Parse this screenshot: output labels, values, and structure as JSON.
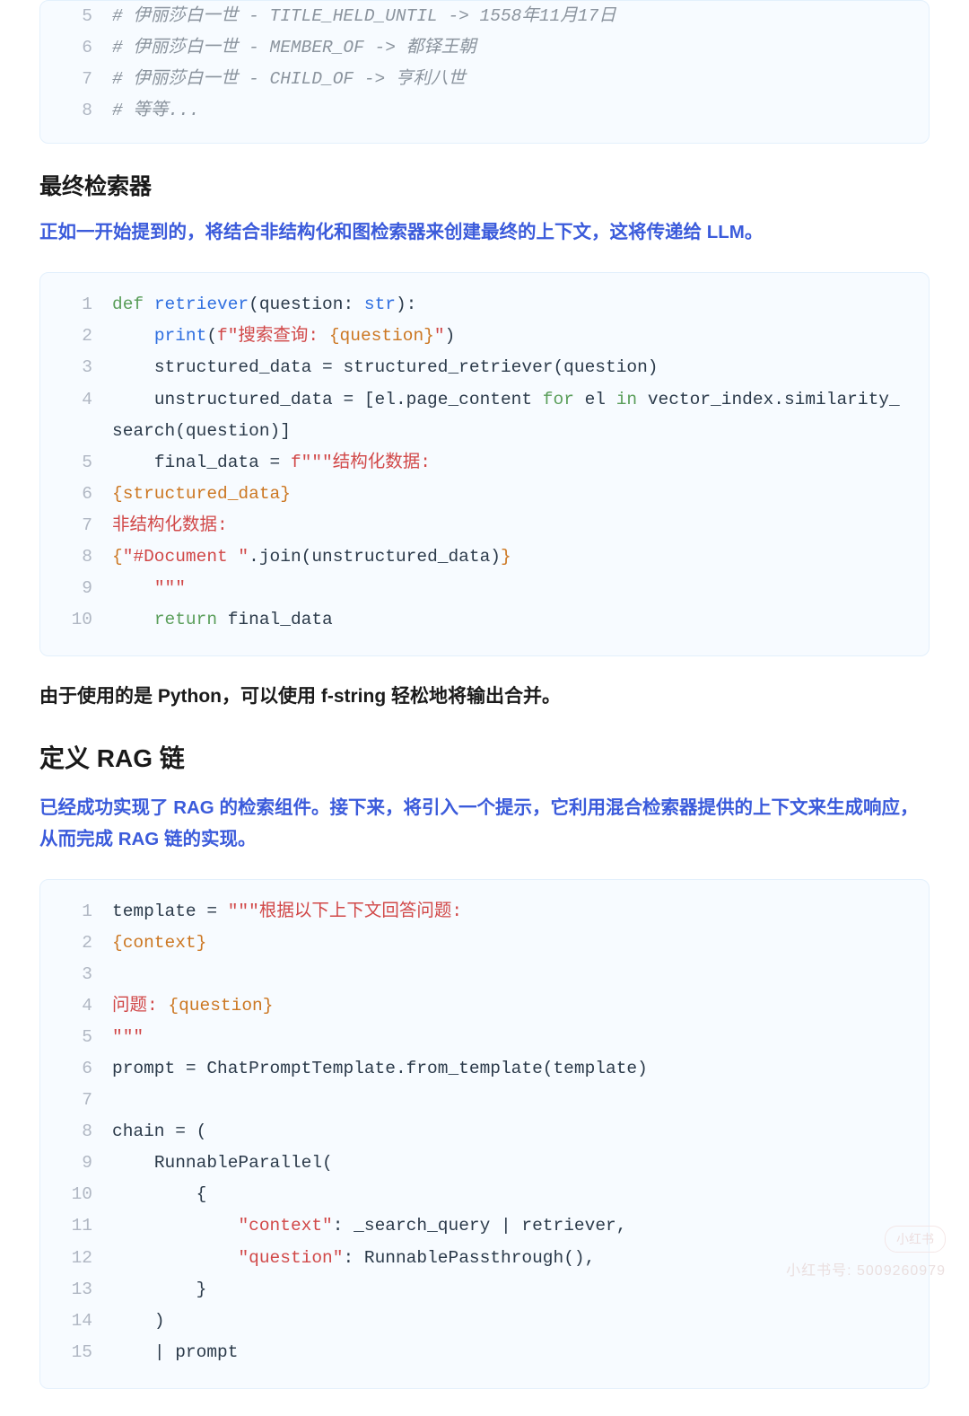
{
  "code_block_1": {
    "lines": [
      {
        "n": 5,
        "segments": [
          {
            "cls": "tok-comment",
            "t": "# 伊丽莎白一世 - TITLE_HELD_UNTIL -> 1558年11月17日"
          }
        ]
      },
      {
        "n": 6,
        "segments": [
          {
            "cls": "tok-comment",
            "t": "# 伊丽莎白一世 - MEMBER_OF -> 都铎王朝"
          }
        ]
      },
      {
        "n": 7,
        "segments": [
          {
            "cls": "tok-comment",
            "t": "# 伊丽莎白一世 - CHILD_OF -> 亨利八世"
          }
        ]
      },
      {
        "n": 8,
        "segments": [
          {
            "cls": "tok-comment",
            "t": "# 等等..."
          }
        ]
      }
    ]
  },
  "section_1": {
    "title": "最终检索器",
    "desc": "正如一开始提到的，将结合非结构化和图检索器来创建最终的上下文，这将传递给 LLM。"
  },
  "code_block_2": {
    "lines": [
      {
        "n": 1,
        "segments": [
          {
            "cls": "tok-keyword",
            "t": "def"
          },
          {
            "cls": "tok-default",
            "t": " "
          },
          {
            "cls": "tok-def",
            "t": "retriever"
          },
          {
            "cls": "tok-default",
            "t": "(question: "
          },
          {
            "cls": "tok-builtin",
            "t": "str"
          },
          {
            "cls": "tok-default",
            "t": "):"
          }
        ]
      },
      {
        "n": 2,
        "segments": [
          {
            "cls": "tok-default",
            "t": "    "
          },
          {
            "cls": "tok-builtin",
            "t": "print"
          },
          {
            "cls": "tok-default",
            "t": "("
          },
          {
            "cls": "tok-string",
            "t": "f\"搜索查询: "
          },
          {
            "cls": "tok-escape",
            "t": "{question}"
          },
          {
            "cls": "tok-string",
            "t": "\""
          },
          {
            "cls": "tok-default",
            "t": ")"
          }
        ]
      },
      {
        "n": 3,
        "segments": [
          {
            "cls": "tok-default",
            "t": "    structured_data = structured_retriever(question)"
          }
        ]
      },
      {
        "n": 4,
        "segments": [
          {
            "cls": "tok-default",
            "t": "    unstructured_data = [el.page_content "
          },
          {
            "cls": "tok-keyword",
            "t": "for"
          },
          {
            "cls": "tok-default",
            "t": " el "
          },
          {
            "cls": "tok-keyword",
            "t": "in"
          },
          {
            "cls": "tok-default",
            "t": " vector_index.similarity_search(question)]"
          }
        ]
      },
      {
        "n": 5,
        "segments": [
          {
            "cls": "tok-default",
            "t": "    final_data = "
          },
          {
            "cls": "tok-string",
            "t": "f\"\"\"结构化数据:"
          }
        ]
      },
      {
        "n": 6,
        "segments": [
          {
            "cls": "tok-escape",
            "t": "{structured_data}"
          }
        ]
      },
      {
        "n": 7,
        "segments": [
          {
            "cls": "tok-string",
            "t": "非结构化数据:"
          }
        ]
      },
      {
        "n": 8,
        "segments": [
          {
            "cls": "tok-escape",
            "t": "{"
          },
          {
            "cls": "tok-string",
            "t": "\"#Document \""
          },
          {
            "cls": "tok-default",
            "t": ".join(unstructured_data)"
          },
          {
            "cls": "tok-escape",
            "t": "}"
          }
        ]
      },
      {
        "n": 9,
        "segments": [
          {
            "cls": "tok-default",
            "t": "    "
          },
          {
            "cls": "tok-string",
            "t": "\"\"\""
          }
        ]
      },
      {
        "n": 10,
        "segments": [
          {
            "cls": "tok-default",
            "t": "    "
          },
          {
            "cls": "tok-keyword",
            "t": "return"
          },
          {
            "cls": "tok-default",
            "t": " final_data"
          }
        ]
      }
    ]
  },
  "body_text_1": "由于使用的是 Python，可以使用 f-string 轻松地将输出合并。",
  "section_2": {
    "title": "定义 RAG 链",
    "desc": "已经成功实现了 RAG 的检索组件。接下来，将引入一个提示，它利用混合检索器提供的上下文来生成响应，从而完成 RAG 链的实现。"
  },
  "code_block_3": {
    "lines": [
      {
        "n": 1,
        "segments": [
          {
            "cls": "tok-default",
            "t": "template = "
          },
          {
            "cls": "tok-string",
            "t": "\"\"\"根据以下上下文回答问题:"
          }
        ]
      },
      {
        "n": 2,
        "segments": [
          {
            "cls": "tok-escape",
            "t": "{context}"
          }
        ]
      },
      {
        "n": 3,
        "segments": [
          {
            "cls": "tok-default",
            "t": ""
          }
        ]
      },
      {
        "n": 4,
        "segments": [
          {
            "cls": "tok-string",
            "t": "问题: "
          },
          {
            "cls": "tok-escape",
            "t": "{question}"
          }
        ]
      },
      {
        "n": 5,
        "segments": [
          {
            "cls": "tok-string",
            "t": "\"\"\""
          }
        ]
      },
      {
        "n": 6,
        "segments": [
          {
            "cls": "tok-default",
            "t": "prompt = ChatPromptTemplate.from_template(template)"
          }
        ]
      },
      {
        "n": 7,
        "segments": [
          {
            "cls": "tok-default",
            "t": ""
          }
        ]
      },
      {
        "n": 8,
        "segments": [
          {
            "cls": "tok-default",
            "t": "chain = ("
          }
        ]
      },
      {
        "n": 9,
        "segments": [
          {
            "cls": "tok-default",
            "t": "    RunnableParallel("
          }
        ]
      },
      {
        "n": 10,
        "segments": [
          {
            "cls": "tok-default",
            "t": "        {"
          }
        ]
      },
      {
        "n": 11,
        "segments": [
          {
            "cls": "tok-default",
            "t": "            "
          },
          {
            "cls": "tok-string",
            "t": "\"context\""
          },
          {
            "cls": "tok-default",
            "t": ": _search_query | retriever,"
          }
        ]
      },
      {
        "n": 12,
        "segments": [
          {
            "cls": "tok-default",
            "t": "            "
          },
          {
            "cls": "tok-string",
            "t": "\"question\""
          },
          {
            "cls": "tok-default",
            "t": ": RunnablePassthrough(),"
          }
        ]
      },
      {
        "n": 13,
        "segments": [
          {
            "cls": "tok-default",
            "t": "        }"
          }
        ]
      },
      {
        "n": 14,
        "segments": [
          {
            "cls": "tok-default",
            "t": "    )"
          }
        ]
      },
      {
        "n": 15,
        "segments": [
          {
            "cls": "tok-default",
            "t": "    | prompt"
          }
        ]
      }
    ]
  },
  "watermark": {
    "badge": "小红书",
    "line": "小红书号: 5009260979"
  }
}
